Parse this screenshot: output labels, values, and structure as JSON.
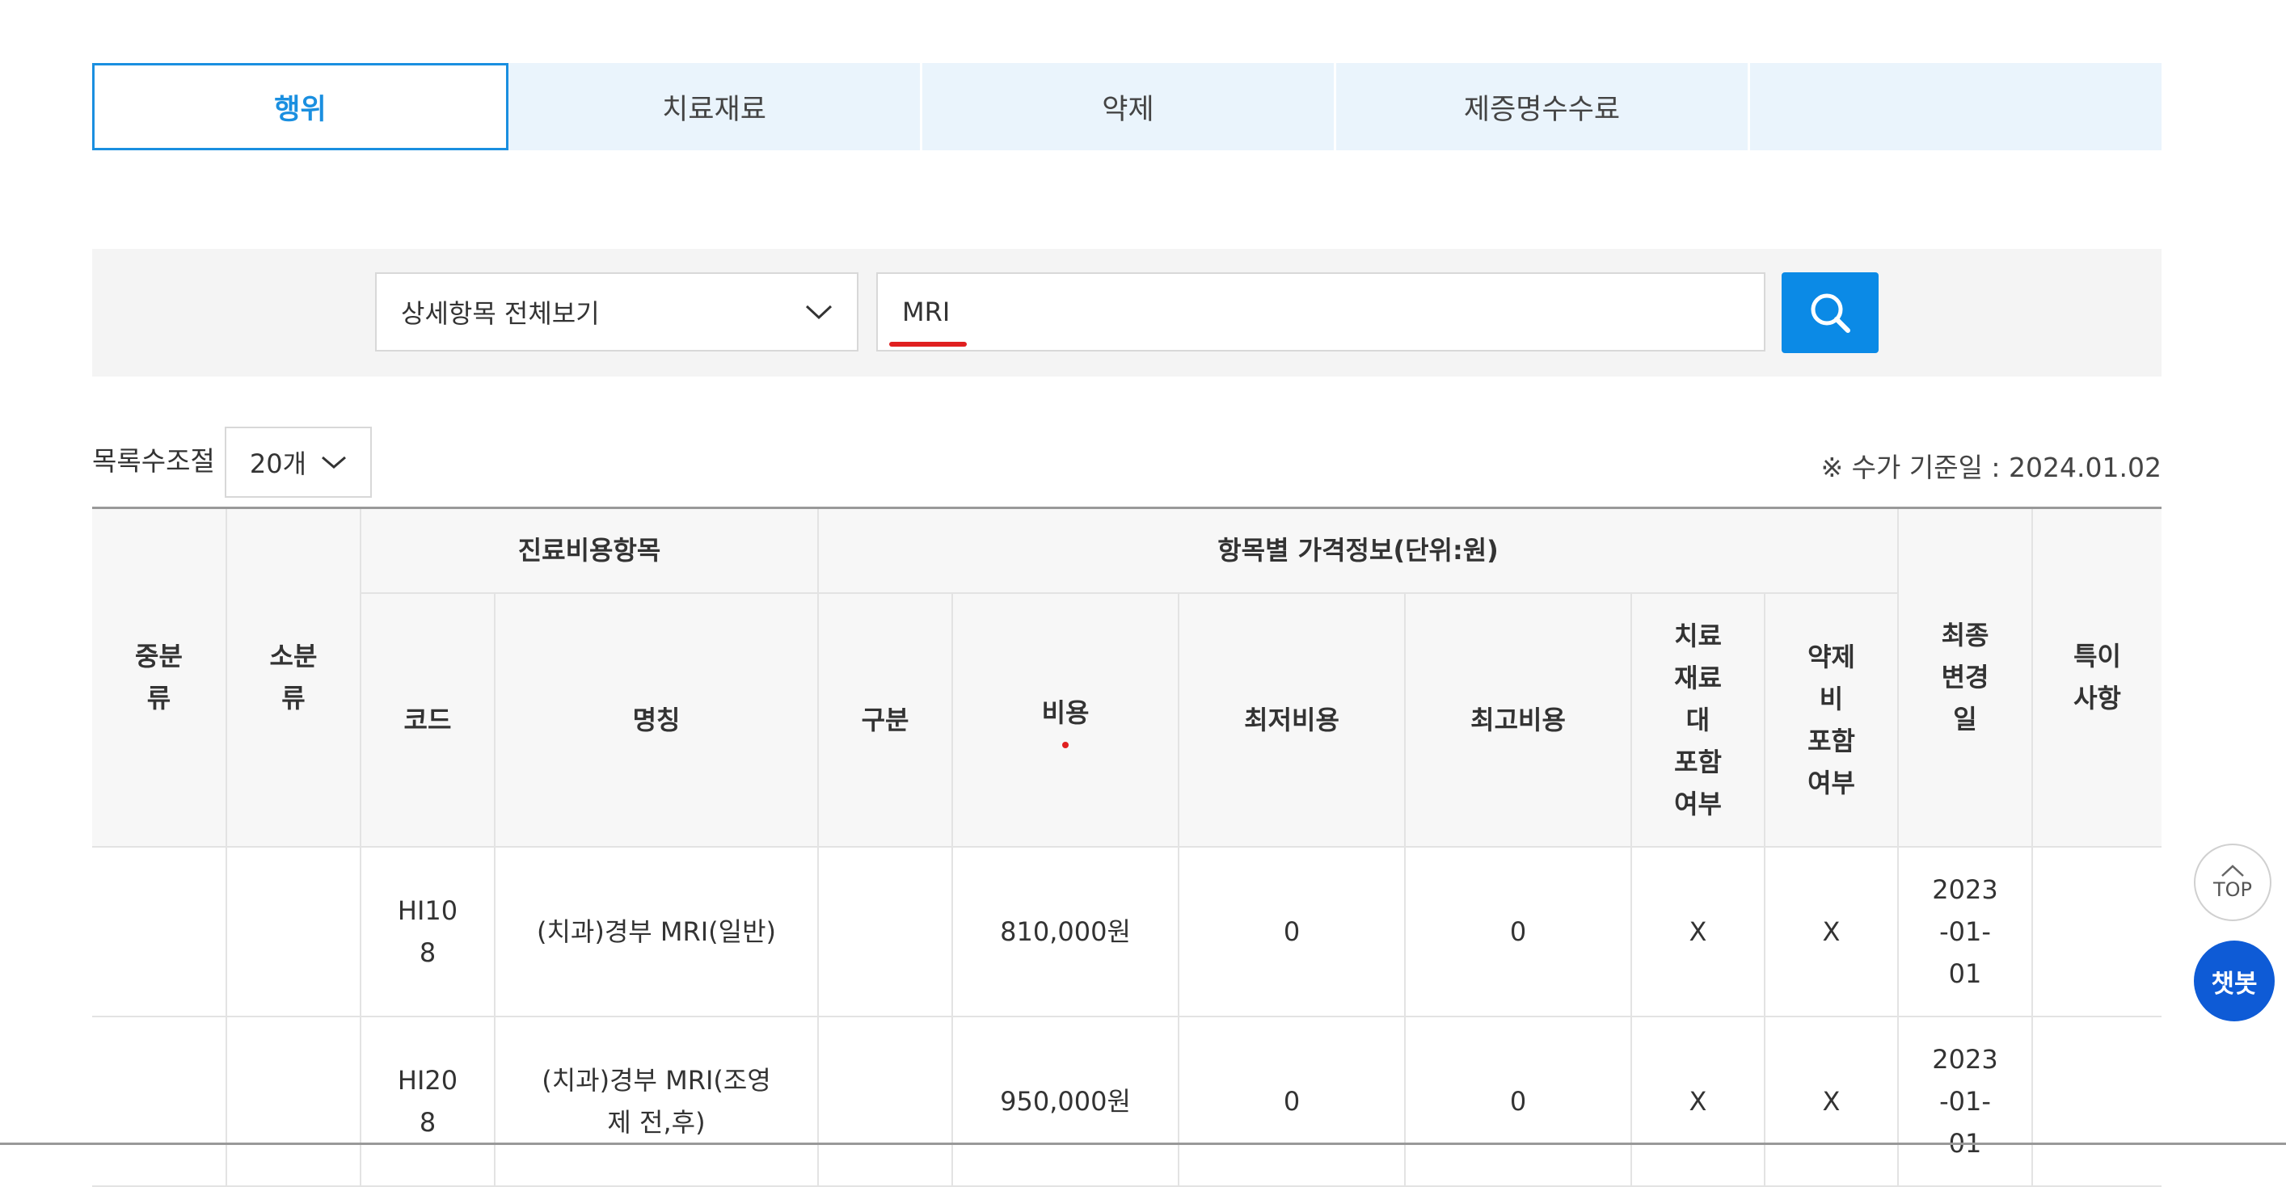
{
  "tabs": [
    {
      "label": "행위",
      "active": true
    },
    {
      "label": "치료재료",
      "active": false
    },
    {
      "label": "약제",
      "active": false
    },
    {
      "label": "제증명수수료",
      "active": false
    },
    {
      "label": "",
      "active": false
    }
  ],
  "search": {
    "scope_select_value": "상세항목 전체보기",
    "query_value": "MRI",
    "button_icon": "search-icon"
  },
  "list": {
    "count_label": "목록수조절",
    "count_value": "20개",
    "base_date_text": "※ 수가 기준일 : 2024.01.02"
  },
  "table": {
    "headers": {
      "mid_category": "중분류",
      "sub_category": "소분류",
      "group_item": "진료비용항목",
      "group_price": "항목별 가격정보(단위:원)",
      "code": "코드",
      "name": "명칭",
      "type": "구분",
      "cost": "비용",
      "min_cost": "최저비용",
      "max_cost": "최고비용",
      "material_included": "치료재료대 포함여부",
      "drug_included": "약제비 포함여부",
      "last_changed": "최종변경일",
      "remarks": "특이사항"
    },
    "rows": [
      {
        "mid_category": "",
        "sub_category": "",
        "code": "HI108",
        "name": "(치과)경부 MRI(일반)",
        "type": "",
        "cost": "810,000원",
        "min_cost": "0",
        "max_cost": "0",
        "material_included": "X",
        "drug_included": "X",
        "last_changed": "2023-01-01",
        "remarks": ""
      },
      {
        "mid_category": "",
        "sub_category": "",
        "code": "HI208",
        "name": "(치과)경부 MRI(조영제 전,후)",
        "type": "",
        "cost": "950,000원",
        "min_cost": "0",
        "max_cost": "0",
        "material_included": "X",
        "drug_included": "X",
        "last_changed": "2023-01-01",
        "remarks": ""
      }
    ]
  },
  "floating": {
    "top_label": "TOP",
    "chatbot_label": "챗봇"
  },
  "colors": {
    "accent_blue": "#1a8fe0",
    "tab_bg": "#eaf4fc",
    "search_button": "#0b8ae6",
    "chatbot": "#0e5bd6",
    "highlight_red": "#e02020"
  }
}
